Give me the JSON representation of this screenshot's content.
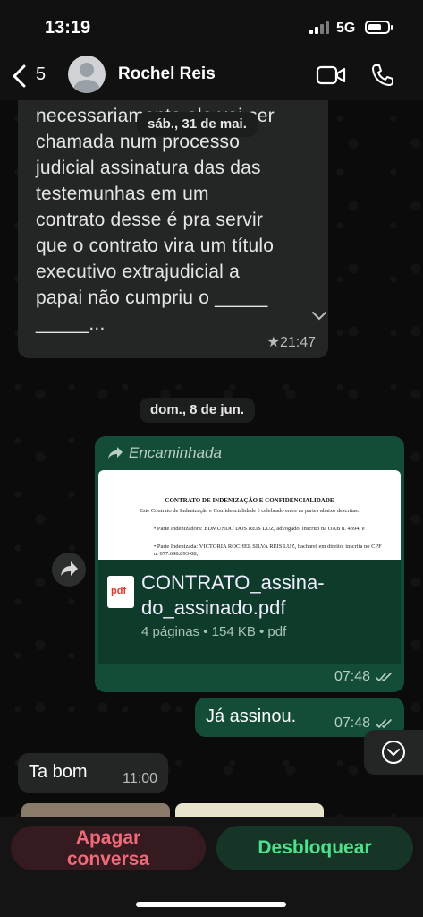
{
  "status_bar": {
    "time": "13:19",
    "network": "5G"
  },
  "header": {
    "back_count": "5",
    "contact_name": "Rochel Reis"
  },
  "messages": {
    "msg1": {
      "lines": [
        "necessariamente ele vai ser",
        "chamada num processo",
        "judicial assinatura das das",
        "testemunhas em um",
        "contrato desse é pra servir",
        "que o contrato vira um título",
        "executivo extrajudicial a",
        "papai não cumpriu o _____",
        "_____..."
      ],
      "time": "★21:47"
    },
    "date1": "sáb., 31 de mai.",
    "date2": "dom., 8 de jun.",
    "msg2": {
      "forwarded_label": "Encaminhada",
      "preview": {
        "title": "CONTRATO DE INDENIZAÇÃO E CONFIDENCIALIDADE",
        "line1": "Este Contrato de Indenização e Confidencialidade é celebrado entre as partes abaixo descritas:",
        "line2": "• Parte Indenizadora: EDMUNDO DOS REIS LUZ, advogado, inscrito na OAB n. 4394, e",
        "line3": "• Parte Indenizada: VICTORIA ROCHEL SILVA REIS LUZ, bacharel em direito, inscrita no CPF n. 077.698.893-08,"
      },
      "file_icon": "pdf",
      "file_name_1": "CONTRATO_assina-",
      "file_name_2": "do_assinado.pdf",
      "file_meta": "4 páginas • 154 KB • pdf",
      "time": "07:48"
    },
    "msg3": {
      "text": "Já assinou.",
      "time": "07:48"
    },
    "msg4": {
      "text": "Ta bom",
      "time": "11:00"
    }
  },
  "actions": {
    "delete_label_1": "Apagar",
    "delete_label_2": "conversa",
    "unblock_label": "Desbloquear"
  },
  "colors": {
    "incoming_bubble": "#242626",
    "outgoing_bubble": "#144d37",
    "delete_text": "#f06a79",
    "unblock_text": "#4fe08c"
  }
}
